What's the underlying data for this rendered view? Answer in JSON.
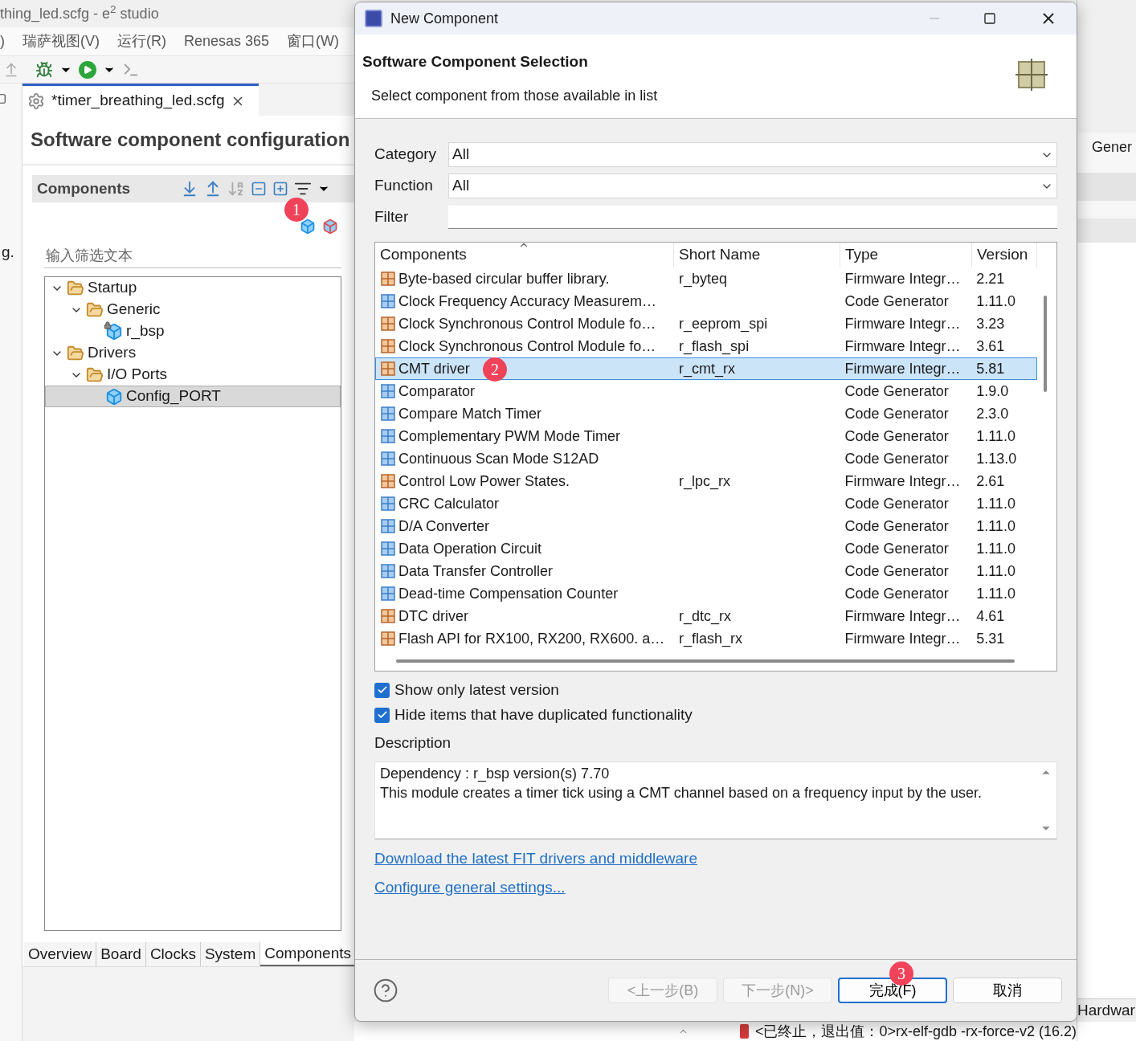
{
  "ide": {
    "title": "thing_led.scfg - e$^{2}$ studio",
    "menu": [
      ")",
      "瑞萨视图(V)",
      "运行(R)",
      "Renesas 365",
      "窗口(W)"
    ],
    "side_text": "g.",
    "editor_tab": {
      "label": "*timer_breathing_led.scfg",
      "selected": true
    },
    "heading": "Software component configuration",
    "panel": {
      "title": "Components",
      "filter_placeholder": "输入筛选文本",
      "tree": [
        {
          "label": "Startup",
          "kind": "folder",
          "expanded": true,
          "selected": false,
          "children": [
            {
              "label": "Generic",
              "kind": "folder",
              "expanded": true,
              "selected": false,
              "children": [
                {
                  "label": "r_bsp",
                  "kind": "locked_component",
                  "selected": false
                }
              ]
            }
          ]
        },
        {
          "label": "Drivers",
          "kind": "folder",
          "expanded": true,
          "selected": false,
          "children": [
            {
              "label": "I/O Ports",
              "kind": "folder",
              "expanded": true,
              "selected": false,
              "children": [
                {
                  "label": "Config_PORT",
                  "kind": "component",
                  "selected": true
                }
              ]
            }
          ]
        }
      ]
    },
    "bottom_tabs": [
      {
        "label": "Overview",
        "selected": false
      },
      {
        "label": "Board",
        "selected": false
      },
      {
        "label": "Clocks",
        "selected": false
      },
      {
        "label": "System",
        "selected": false
      },
      {
        "label": "Components",
        "selected": true
      }
    ],
    "right_tab": "Gener",
    "right_bottom_tab": "Hardwar",
    "console_status": "<已终止，退出值：0>rx-elf-gdb -rx-force-v2 (16.2)"
  },
  "dialog": {
    "title": "New Component",
    "heading": "Software Component Selection",
    "subtitle": "Select component from those available in list",
    "fields": [
      {
        "label": "Category",
        "kind": "select",
        "value": "All"
      },
      {
        "label": "Function",
        "kind": "select",
        "value": "All"
      },
      {
        "label": "Filter",
        "kind": "text"
      }
    ],
    "table": {
      "columns": [
        "Components",
        "Short Name",
        "Type",
        "Version"
      ],
      "rows": [
        {
          "kind": "firmware",
          "name": "Byte-based circular buffer library.",
          "short": "r_byteq",
          "type": "Firmware Integr…",
          "version": "2.21",
          "selected": false
        },
        {
          "kind": "code_generator",
          "name": "Clock Frequency Accuracy Measurem…",
          "type": "Code Generator",
          "version": "1.11.0",
          "selected": false
        },
        {
          "kind": "firmware",
          "name": "Clock Synchronous Control Module fo…",
          "short": "r_eeprom_spi",
          "type": "Firmware Integr…",
          "version": "3.23",
          "selected": false
        },
        {
          "kind": "firmware",
          "name": "Clock Synchronous Control Module fo…",
          "short": "r_flash_spi",
          "type": "Firmware Integr…",
          "version": "3.61",
          "selected": false
        },
        {
          "kind": "firmware",
          "name": "CMT driver",
          "short": "r_cmt_rx",
          "type": "Firmware Integr…",
          "version": "5.81",
          "selected": true
        },
        {
          "kind": "code_generator",
          "name": "Comparator",
          "type": "Code Generator",
          "version": "1.9.0",
          "selected": false
        },
        {
          "kind": "code_generator",
          "name": "Compare Match Timer",
          "type": "Code Generator",
          "version": "2.3.0",
          "selected": false
        },
        {
          "kind": "code_generator",
          "name": "Complementary PWM Mode Timer",
          "type": "Code Generator",
          "version": "1.11.0",
          "selected": false
        },
        {
          "kind": "code_generator",
          "name": "Continuous Scan Mode S12AD",
          "type": "Code Generator",
          "version": "1.13.0",
          "selected": false
        },
        {
          "kind": "firmware",
          "name": "Control Low Power States.",
          "short": "r_lpc_rx",
          "type": "Firmware Integr…",
          "version": "2.61",
          "selected": false
        },
        {
          "kind": "code_generator",
          "name": "CRC Calculator",
          "type": "Code Generator",
          "version": "1.11.0",
          "selected": false
        },
        {
          "kind": "code_generator",
          "name": "D/A Converter",
          "type": "Code Generator",
          "version": "1.11.0",
          "selected": false
        },
        {
          "kind": "code_generator",
          "name": "Data Operation Circuit",
          "type": "Code Generator",
          "version": "1.11.0",
          "selected": false
        },
        {
          "kind": "code_generator",
          "name": "Data Transfer Controller",
          "type": "Code Generator",
          "version": "1.11.0",
          "selected": false
        },
        {
          "kind": "code_generator",
          "name": "Dead-time Compensation Counter",
          "type": "Code Generator",
          "version": "1.11.0",
          "selected": false
        },
        {
          "kind": "firmware",
          "name": "DTC driver",
          "short": "r_dtc_rx",
          "type": "Firmware Integr…",
          "version": "4.61",
          "selected": false
        },
        {
          "kind": "firmware",
          "name": "Flash API for RX100, RX200, RX600. a…",
          "short": "r_flash_rx",
          "type": "Firmware Integr…",
          "version": "5.31",
          "selected": false
        }
      ]
    },
    "checkboxes": [
      {
        "label": "Show only latest version",
        "checked": true
      },
      {
        "label": "Hide items that have duplicated functionality",
        "checked": true
      }
    ],
    "description_label": "Description",
    "description": [
      "Dependency : r_bsp version(s) 7.70",
      "This module creates a timer tick using a CMT channel based on a frequency input by the user."
    ],
    "links": [
      "Download the latest FIT drivers and middleware",
      "Configure general settings..."
    ],
    "buttons": [
      {
        "label": "<上一步(B)",
        "disabled": true,
        "default": false
      },
      {
        "label": "下一步(N)>",
        "disabled": true,
        "default": false
      },
      {
        "label": "完成(F)",
        "disabled": false,
        "default": true
      },
      {
        "label": "取消",
        "disabled": false,
        "default": false
      }
    ]
  },
  "annotations": [
    "1",
    "2",
    "3"
  ]
}
